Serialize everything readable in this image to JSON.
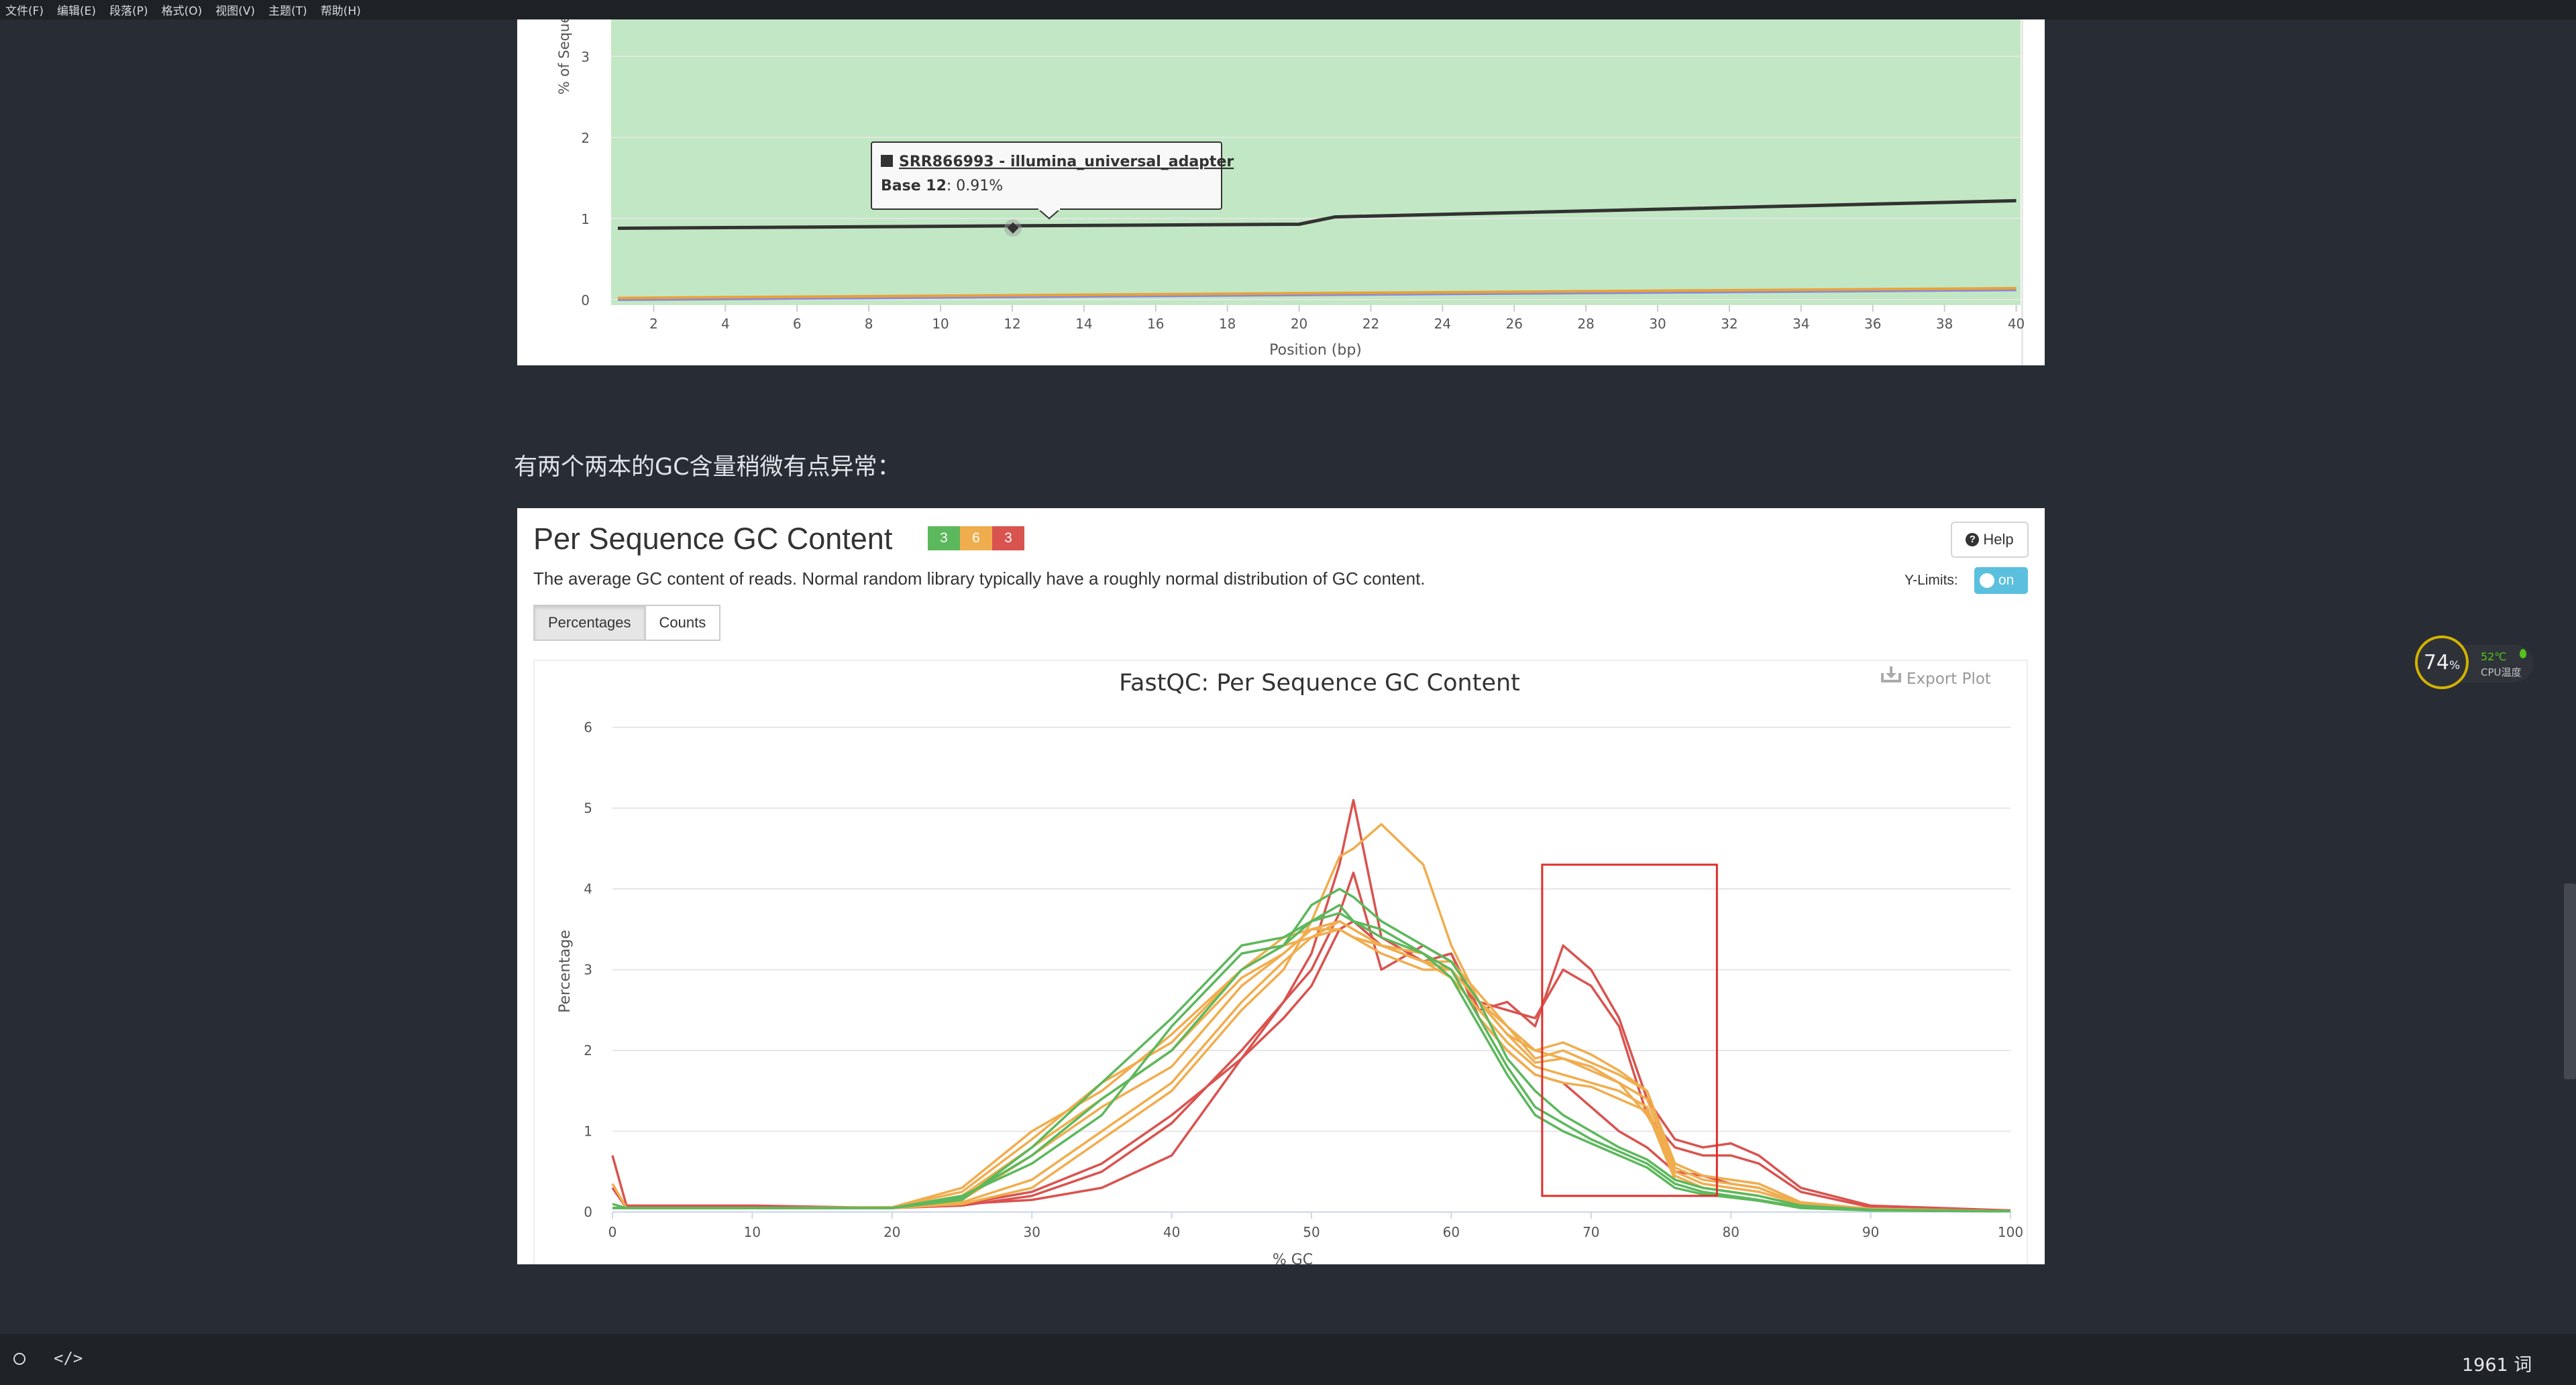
{
  "menubar": {
    "items": [
      "文件(F)",
      "编辑(E)",
      "段落(P)",
      "格式(O)",
      "视图(V)",
      "主题(T)",
      "帮助(H)"
    ]
  },
  "top_chart": {
    "ylabel": "% of Sequenc",
    "xlabel": "Position (bp)",
    "y_ticks": [
      "0",
      "1",
      "2",
      "3"
    ],
    "x_ticks": [
      "2",
      "4",
      "6",
      "8",
      "10",
      "12",
      "14",
      "16",
      "18",
      "20",
      "22",
      "24",
      "26",
      "28",
      "30",
      "32",
      "34",
      "36",
      "38",
      "40"
    ],
    "tooltip": {
      "title": "SRR866993 - illumina_universal_adapter",
      "label": "Base 12",
      "value": ": 0.91%"
    },
    "colors": {
      "background": "#c2e7c4",
      "line": "#333333"
    }
  },
  "paragraph": {
    "text": "有两个两本的GC含量稍微有点异常："
  },
  "gc_section": {
    "title": "Per Sequence GC Content",
    "badges": [
      {
        "value": "3",
        "color": "#5cb85c"
      },
      {
        "value": "6",
        "color": "#f0ad4e"
      },
      {
        "value": "3",
        "color": "#d9534f"
      }
    ],
    "help_label": "Help",
    "description": "The average GC content of reads. Normal random library typically have a roughly normal distribution of GC content.",
    "ylimits_label": "Y-Limits:",
    "toggle_label": "on",
    "tabs": [
      "Percentages",
      "Counts"
    ],
    "plot_title": "FastQC: Per Sequence GC Content",
    "export_label": "Export Plot"
  },
  "chart_data": [
    {
      "type": "line",
      "xlabel": "Position (bp)",
      "ylabel": "% of Sequenc",
      "xlim": [
        1,
        40
      ],
      "ylim": [
        0,
        3.5
      ],
      "series": [
        {
          "name": "SRR866993 - illumina_universal_adapter",
          "color": "#333333",
          "x": [
            1,
            12,
            20,
            21,
            40
          ],
          "y": [
            0.88,
            0.91,
            0.93,
            1.02,
            1.22
          ]
        },
        {
          "color": "#e8a23a",
          "x": [
            1,
            40
          ],
          "y": [
            0.02,
            0.14
          ]
        },
        {
          "color": "#8888dd",
          "x": [
            1,
            40
          ],
          "y": [
            0.0,
            0.12
          ]
        }
      ]
    },
    {
      "type": "line",
      "title": "FastQC: Per Sequence GC Content",
      "xlabel": "% GC",
      "ylabel": "Percentage",
      "xlim": [
        0,
        100
      ],
      "ylim": [
        0,
        6
      ],
      "x_ticks": [
        0,
        10,
        20,
        30,
        40,
        50,
        60,
        70,
        80,
        90,
        100
      ],
      "y_ticks": [
        0,
        1,
        2,
        3,
        4,
        5,
        6
      ],
      "x": [
        0,
        1,
        5,
        10,
        20,
        25,
        30,
        35,
        40,
        45,
        48,
        50,
        52,
        53,
        55,
        58,
        60,
        62,
        64,
        66,
        68,
        70,
        72,
        74,
        76,
        78,
        80,
        82,
        85,
        90,
        100
      ],
      "series": [
        {
          "color": "#d9534f",
          "y": [
            0.7,
            0.08,
            0.08,
            0.08,
            0.05,
            0.1,
            0.15,
            0.3,
            0.7,
            1.9,
            2.6,
            3.2,
            4.3,
            5.1,
            3.4,
            3.1,
            3.2,
            2.5,
            2.6,
            2.3,
            3.3,
            3.0,
            2.4,
            1.4,
            0.9,
            0.8,
            0.85,
            0.7,
            0.3,
            0.08,
            0.02
          ]
        },
        {
          "color": "#d9534f",
          "y": [
            0.3,
            0.05,
            0.05,
            0.05,
            0.05,
            0.08,
            0.2,
            0.5,
            1.1,
            2.0,
            2.6,
            3.0,
            3.7,
            4.2,
            3.0,
            3.3,
            3.1,
            2.6,
            2.5,
            2.4,
            3.0,
            2.8,
            2.3,
            1.2,
            0.8,
            0.7,
            0.7,
            0.6,
            0.25,
            0.06,
            0.02
          ]
        },
        {
          "color": "#d9534f",
          "y": [
            0.05,
            0.05,
            0.05,
            0.05,
            0.05,
            0.1,
            0.25,
            0.6,
            1.2,
            1.9,
            2.4,
            2.8,
            3.5,
            3.6,
            3.3,
            3.1,
            3.2,
            2.4,
            2.0,
            1.7,
            1.6,
            1.3,
            1.0,
            0.8,
            0.5,
            0.45,
            0.35,
            0.3,
            0.1,
            0.03,
            0.01
          ]
        },
        {
          "color": "#f0ad4e",
          "y": [
            0.35,
            0.05,
            0.05,
            0.05,
            0.05,
            0.1,
            0.3,
            0.9,
            1.5,
            2.5,
            3.0,
            3.6,
            4.4,
            4.5,
            4.8,
            4.3,
            3.3,
            2.6,
            2.3,
            2.0,
            1.9,
            1.8,
            1.6,
            1.2,
            0.6,
            0.45,
            0.4,
            0.35,
            0.12,
            0.04,
            0.01
          ]
        },
        {
          "color": "#f0ad4e",
          "y": [
            0.05,
            0.05,
            0.05,
            0.05,
            0.05,
            0.12,
            0.4,
            1.0,
            1.6,
            2.6,
            3.1,
            3.4,
            3.6,
            3.5,
            3.3,
            3.1,
            3.0,
            2.6,
            2.2,
            2.0,
            2.1,
            1.95,
            1.75,
            1.5,
            0.6,
            0.45,
            0.4,
            0.35,
            0.12,
            0.04,
            0.01
          ]
        },
        {
          "color": "#f0ad4e",
          "y": [
            0.05,
            0.05,
            0.05,
            0.05,
            0.05,
            0.15,
            0.7,
            1.3,
            1.8,
            2.8,
            3.2,
            3.5,
            3.6,
            3.5,
            3.3,
            3.1,
            3.1,
            2.7,
            2.3,
            1.9,
            2.0,
            1.85,
            1.7,
            1.5,
            0.55,
            0.4,
            0.35,
            0.3,
            0.1,
            0.04,
            0.01
          ]
        },
        {
          "color": "#f0ad4e",
          "y": [
            0.05,
            0.05,
            0.05,
            0.05,
            0.05,
            0.2,
            0.8,
            1.4,
            2.0,
            2.9,
            3.2,
            3.5,
            3.5,
            3.4,
            3.2,
            3.0,
            3.0,
            2.6,
            2.2,
            1.85,
            1.9,
            1.75,
            1.6,
            1.4,
            0.5,
            0.35,
            0.3,
            0.25,
            0.1,
            0.03,
            0.01
          ]
        },
        {
          "color": "#f0ad4e",
          "y": [
            0.05,
            0.05,
            0.05,
            0.05,
            0.06,
            0.25,
            0.9,
            1.6,
            2.1,
            3.0,
            3.3,
            3.4,
            3.5,
            3.4,
            3.3,
            3.1,
            2.9,
            2.5,
            2.1,
            1.8,
            1.7,
            1.6,
            1.5,
            1.3,
            0.45,
            0.3,
            0.25,
            0.2,
            0.08,
            0.03,
            0.01
          ]
        },
        {
          "color": "#f0ad4e",
          "y": [
            0.05,
            0.05,
            0.05,
            0.05,
            0.06,
            0.3,
            1.0,
            1.5,
            2.2,
            3.0,
            3.4,
            3.5,
            3.5,
            3.4,
            3.3,
            3.2,
            3.0,
            2.4,
            2.0,
            1.7,
            1.6,
            1.55,
            1.4,
            1.25,
            0.4,
            0.3,
            0.25,
            0.2,
            0.08,
            0.03,
            0.01
          ]
        },
        {
          "color": "#5cb85c",
          "y": [
            0.1,
            0.05,
            0.05,
            0.05,
            0.05,
            0.2,
            0.6,
            1.2,
            2.3,
            3.2,
            3.3,
            3.8,
            4.0,
            3.9,
            3.6,
            3.3,
            3.1,
            2.6,
            1.9,
            1.5,
            1.2,
            1.0,
            0.8,
            0.65,
            0.4,
            0.3,
            0.25,
            0.2,
            0.08,
            0.03,
            0.01
          ]
        },
        {
          "color": "#5cb85c",
          "y": [
            0.05,
            0.05,
            0.05,
            0.05,
            0.05,
            0.18,
            0.7,
            1.4,
            2.0,
            3.0,
            3.3,
            3.6,
            3.7,
            3.6,
            3.4,
            3.2,
            3.0,
            2.4,
            1.8,
            1.3,
            1.1,
            0.9,
            0.75,
            0.6,
            0.35,
            0.25,
            0.2,
            0.15,
            0.06,
            0.02,
            0.01
          ]
        },
        {
          "color": "#5cb85c",
          "y": [
            0.05,
            0.05,
            0.05,
            0.05,
            0.05,
            0.15,
            0.8,
            1.6,
            2.4,
            3.3,
            3.4,
            3.6,
            3.8,
            3.6,
            3.5,
            3.2,
            2.9,
            2.3,
            1.7,
            1.2,
            1.0,
            0.85,
            0.7,
            0.55,
            0.3,
            0.22,
            0.18,
            0.14,
            0.05,
            0.02,
            0.01
          ]
        }
      ],
      "annotation": {
        "type": "highlight-box",
        "color": "#e0302a",
        "x_range": [
          66.5,
          79
        ],
        "y_range": [
          0.2,
          4.3
        ]
      }
    }
  ],
  "cpu_widget": {
    "percent": "74",
    "percent_sign": "%",
    "temp": "52℃",
    "label": "CPU温度"
  },
  "statusbar": {
    "wordcount": "1961 词"
  }
}
